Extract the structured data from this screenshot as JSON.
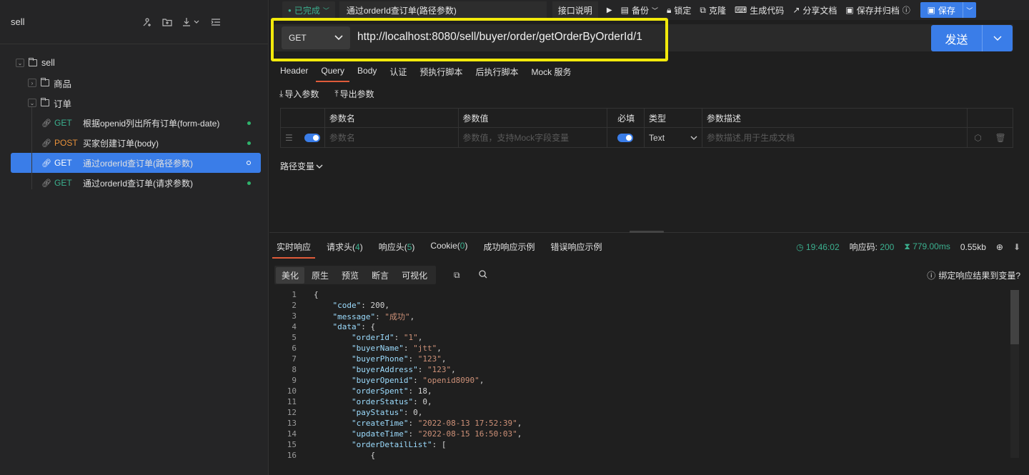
{
  "sidebar": {
    "title": "sell",
    "root": {
      "label": "sell"
    },
    "folders": [
      {
        "label": "商品"
      },
      {
        "label": "订单"
      }
    ],
    "apis": [
      {
        "method": "GET",
        "name": "根据openid列出所有订单(form-date)"
      },
      {
        "method": "POST",
        "name": "买家创建订单(body)"
      },
      {
        "method": "GET",
        "name": "通过orderId查订单(路径参数)"
      },
      {
        "method": "GET",
        "name": "通过orderId查订单(请求参数)"
      }
    ]
  },
  "topbar": {
    "status": "已完成",
    "tab_title": "通过orderId查订单(路径参数)",
    "api_doc": "接口说明",
    "backup": "备份",
    "lock": "锁定",
    "clone": "克隆",
    "gen_code": "生成代码",
    "share_doc": "分享文档",
    "save_archive": "保存并归档",
    "save": "保存"
  },
  "request": {
    "method": "GET",
    "url": "http://localhost:8080/sell/buyer/order/getOrderByOrderId/1",
    "send": "发送",
    "tabs": [
      "Header",
      "Query",
      "Body",
      "认证",
      "预执行脚本",
      "后执行脚本",
      "Mock 服务"
    ],
    "import_params": "导入参数",
    "export_params": "导出参数",
    "table_headers": {
      "name": "参数名",
      "value": "参数值",
      "required": "必填",
      "type": "类型",
      "desc": "参数描述"
    },
    "row": {
      "name_placeholder": "参数名",
      "value_placeholder": "参数值，支持Mock字段变量",
      "type": "Text",
      "desc_placeholder": "参数描述,用于生成文档"
    },
    "path_vars": "路径变量"
  },
  "response": {
    "tabs": [
      {
        "label": "实时响应",
        "count": ""
      },
      {
        "label": "请求头",
        "count": "4"
      },
      {
        "label": "响应头",
        "count": "5"
      },
      {
        "label": "Cookie",
        "count": "0"
      },
      {
        "label": "成功响应示例",
        "count": ""
      },
      {
        "label": "错误响应示例",
        "count": ""
      }
    ],
    "time": "19:46:02",
    "code_label": "响应码:",
    "code": "200",
    "duration": "779.00ms",
    "size": "0.55kb",
    "formats": [
      "美化",
      "原生",
      "预览",
      "断言",
      "可视化"
    ],
    "bind_var": "绑定响应结果到变量?"
  },
  "code_lines": [
    {
      "n": "1",
      "indent": "",
      "key": "",
      "val": "{"
    },
    {
      "n": "2",
      "indent": "    ",
      "key": "\"code\"",
      "val": ": 200,"
    },
    {
      "n": "3",
      "indent": "    ",
      "key": "\"message\"",
      "sval": "\"成功\"",
      "tail": ","
    },
    {
      "n": "4",
      "indent": "    ",
      "key": "\"data\"",
      "val": ": {"
    },
    {
      "n": "5",
      "indent": "        ",
      "key": "\"orderId\"",
      "sval": "\"1\"",
      "tail": ","
    },
    {
      "n": "6",
      "indent": "        ",
      "key": "\"buyerName\"",
      "sval": "\"jtt\"",
      "tail": ","
    },
    {
      "n": "7",
      "indent": "        ",
      "key": "\"buyerPhone\"",
      "sval": "\"123\"",
      "tail": ","
    },
    {
      "n": "8",
      "indent": "        ",
      "key": "\"buyerAddress\"",
      "sval": "\"123\"",
      "tail": ","
    },
    {
      "n": "9",
      "indent": "        ",
      "key": "\"buyerOpenid\"",
      "sval": "\"openid8090\"",
      "tail": ","
    },
    {
      "n": "10",
      "indent": "        ",
      "key": "\"orderSpent\"",
      "val": ": 18,"
    },
    {
      "n": "11",
      "indent": "        ",
      "key": "\"orderStatus\"",
      "val": ": 0,"
    },
    {
      "n": "12",
      "indent": "        ",
      "key": "\"payStatus\"",
      "val": ": 0,"
    },
    {
      "n": "13",
      "indent": "        ",
      "key": "\"createTime\"",
      "sval": "\"2022-08-13 17:52:39\"",
      "tail": ","
    },
    {
      "n": "14",
      "indent": "        ",
      "key": "\"updateTime\"",
      "sval": "\"2022-08-15 16:50:03\"",
      "tail": ","
    },
    {
      "n": "15",
      "indent": "        ",
      "key": "\"orderDetailList\"",
      "val": ": ["
    },
    {
      "n": "16",
      "indent": "            ",
      "key": "",
      "val": "{"
    }
  ]
}
